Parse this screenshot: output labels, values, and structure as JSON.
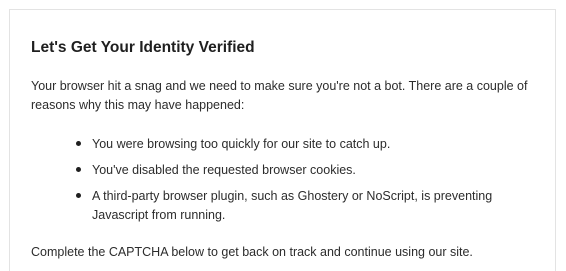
{
  "heading": "Let's Get Your Identity Verified",
  "intro": "Your browser hit a snag and we need to make sure you're not a bot. There are a couple of reasons why this may have happened:",
  "reasons": [
    "You were browsing too quickly for our site to catch up.",
    "You've disabled the requested browser cookies.",
    "A third-party browser plugin, such as Ghostery or NoScript, is preventing Javascript from running."
  ],
  "outro": "Complete the CAPTCHA below to get back on track and continue using our site."
}
